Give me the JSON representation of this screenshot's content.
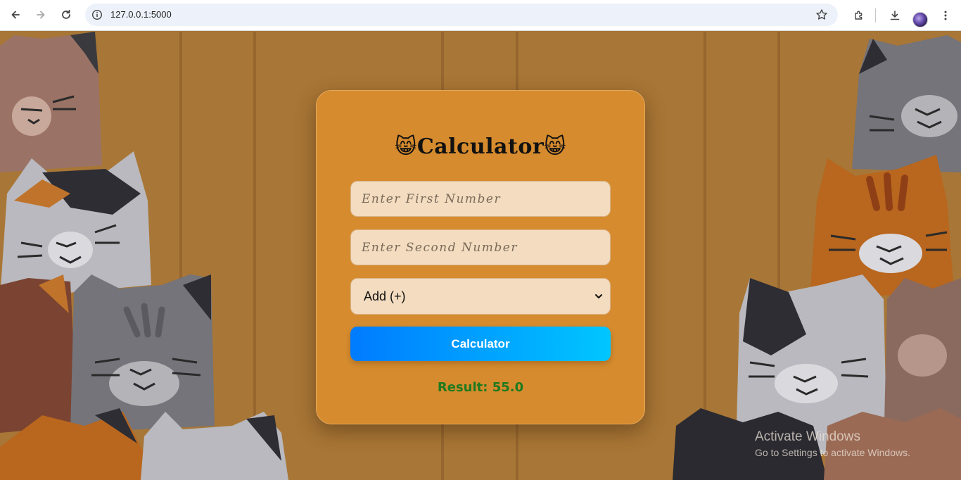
{
  "browser": {
    "url": "127.0.0.1:5000"
  },
  "app": {
    "title_emoji": "😸",
    "title_text": "Calculator",
    "first_placeholder": "Enter First Number",
    "second_placeholder": "Enter Second Number",
    "operation_selected": "Add (+)",
    "button_label": "Calculator",
    "result_text": "Result: 55.0"
  },
  "watermark": {
    "line1": "Activate Windows",
    "line2": "Go to Settings to activate Windows."
  },
  "colors": {
    "background": "#a87636",
    "card": "#d68b2e",
    "input": "#f3dcbf",
    "button_start": "#007bff",
    "button_end": "#00c6ff",
    "result": "#1f7a1f"
  }
}
